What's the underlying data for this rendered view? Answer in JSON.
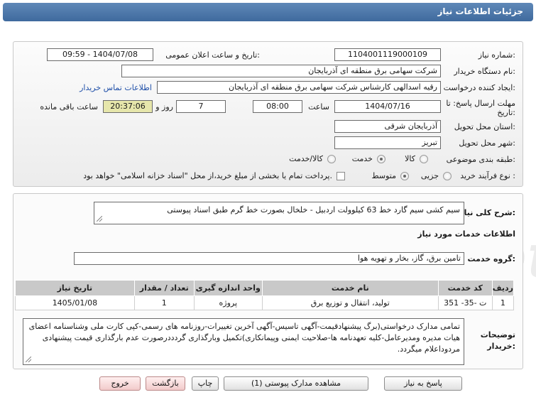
{
  "header": {
    "title": "جزئیات اطلاعات نیاز"
  },
  "form": {
    "need_number_label": "شماره نیاز:",
    "need_number": "1104001119000109",
    "announce_label": "تاریخ و ساعت اعلان عمومی:",
    "announce_value": "1404/07/08 - 09:59",
    "buyer_org_label": "نام دستگاه خریدار:",
    "buyer_org": "شرکت سهامی برق منطقه ای آذربایجان",
    "creator_label": "ایجاد کننده درخواست:",
    "creator": "رقیه اسدالهی کارشناس شرکت سهامی برق منطقه ای آذربایجان",
    "contact_link": "اطلاعات تماس خریدار",
    "deadline_label_1": "مهلت ارسال پاسخ: تا",
    "deadline_label_2": "تاریخ:",
    "deadline_date": "1404/07/16",
    "hour_label": "ساعت",
    "deadline_hour": "08:00",
    "days_value": "7",
    "days_label": "روز و",
    "remaining_time": "20:37:06",
    "remaining_label": "ساعت باقی مانده",
    "province_label": "استان محل تحویل:",
    "province": "آذربایجان شرقی",
    "city_label": "شهر محل تحویل:",
    "city": "تبریز",
    "category_label": "طبقه بندی موضوعی:",
    "category_options": [
      "کالا",
      "خدمت",
      "کالا/خدمت"
    ],
    "category_selected": "خدمت",
    "process_label": "نوع فرآیند خرید :",
    "process_options": [
      "جزیی",
      "متوسط"
    ],
    "process_selected": "متوسط",
    "payment_note": "پرداخت تمام یا بخشی از مبلغ خرید،از محل \"اسناد خزانه اسلامی\" خواهد بود."
  },
  "details": {
    "summary_label": "شرح کلی نیاز:",
    "summary": "سیم کشی سیم گارد خط 63 کیلوولت اردبیل - خلخال بصورت خط گرم طبق اسناد پیوستی",
    "services_heading": "اطلاعات خدمات مورد نیاز",
    "service_group_label": "گروه خدمت:",
    "service_group": "تامین برق، گاز، بخار و تهویه هوا",
    "table": {
      "columns": [
        "ردیف",
        "کد خدمت",
        "نام خدمت",
        "واحد اندازه گیری",
        "تعداد / مقدار",
        "تاریخ نیاز"
      ],
      "rows": [
        [
          "1",
          "ت -35- 351",
          "تولید، انتقال و توزیع برق",
          "پروژه",
          "1",
          "1405/01/08"
        ]
      ]
    },
    "buyer_notes_label_1": "توضیحات",
    "buyer_notes_label_2": "خریدار:",
    "buyer_notes": "تمامی مدارک درخواستی(برگ پیشنهادقیمت-آگهی تاسیس-آگهی آخرین تغییرات-روزنامه های رسمی-کپی کارت ملی وشناسنامه اعضای هیات مدیره ومدیرعامل-کلیه تعهدنامه ها-صلاحیت ایمنی وپیمانکاری)تکمیل وبارگذاری گردددرصورت عدم بارگذاری قیمت پیشنهادی مردوداعلام میگردد."
  },
  "watermark": {
    "text": "AriaTender.net"
  },
  "buttons": {
    "reply": "پاسخ به نیاز",
    "attachments": "مشاهده مدارک پیوستی (1)",
    "print": "چاپ",
    "back": "بازگشت",
    "exit": "خروج"
  }
}
